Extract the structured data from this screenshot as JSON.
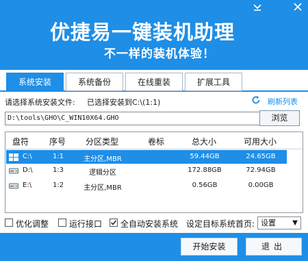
{
  "window": {
    "title": "优捷易一键装机助理",
    "subtitle": "不一样的装机体验！",
    "minimize_icon": "minimize-icon",
    "close_icon": "close-icon",
    "accent_color": "#1e8ee7"
  },
  "tabs": [
    {
      "label": "系统安装",
      "active": true
    },
    {
      "label": "系统备份",
      "active": false
    },
    {
      "label": "在线重装",
      "active": false
    },
    {
      "label": "扩展工具",
      "active": false
    }
  ],
  "selection": {
    "prompt": "请选择系统安装文件:",
    "status": "已选择安装到C:\\(1:1)",
    "refresh_label": "刷新列表",
    "path_value": "D:\\tools\\GHO\\C_WIN10X64.GHO",
    "browse_label": "浏览"
  },
  "table": {
    "headers": [
      "盘符",
      "序号",
      "分区类型",
      "卷标",
      "总大小",
      "可用大小"
    ],
    "rows": [
      {
        "drive": "C:\\",
        "index": "1:1",
        "type": "主分区,MBR",
        "label": "",
        "total": "59.44GB",
        "free": "24.65GB",
        "selected": true,
        "icon": "windows-drive-icon"
      },
      {
        "drive": "D:\\",
        "index": "1:3",
        "type": "逻辑分区",
        "label": "",
        "total": "172.88GB",
        "free": "72.94GB",
        "selected": false,
        "icon": "hard-drive-icon"
      },
      {
        "drive": "E:\\",
        "index": "1:2",
        "type": "主分区,MBR",
        "label": "",
        "total": "0.56GB",
        "free": "0.00GB",
        "selected": false,
        "icon": "hard-drive-icon"
      }
    ]
  },
  "options": {
    "optimize": {
      "label": "优化调整",
      "checked": false
    },
    "run_interface": {
      "label": "运行接口",
      "checked": false
    },
    "auto_install": {
      "label": "全自动安装系统",
      "checked": true
    },
    "homepage_label": "设定目标系统首页:",
    "homepage_value": "设置"
  },
  "footer": {
    "start_label": "开始安装",
    "exit_label": "退出"
  }
}
